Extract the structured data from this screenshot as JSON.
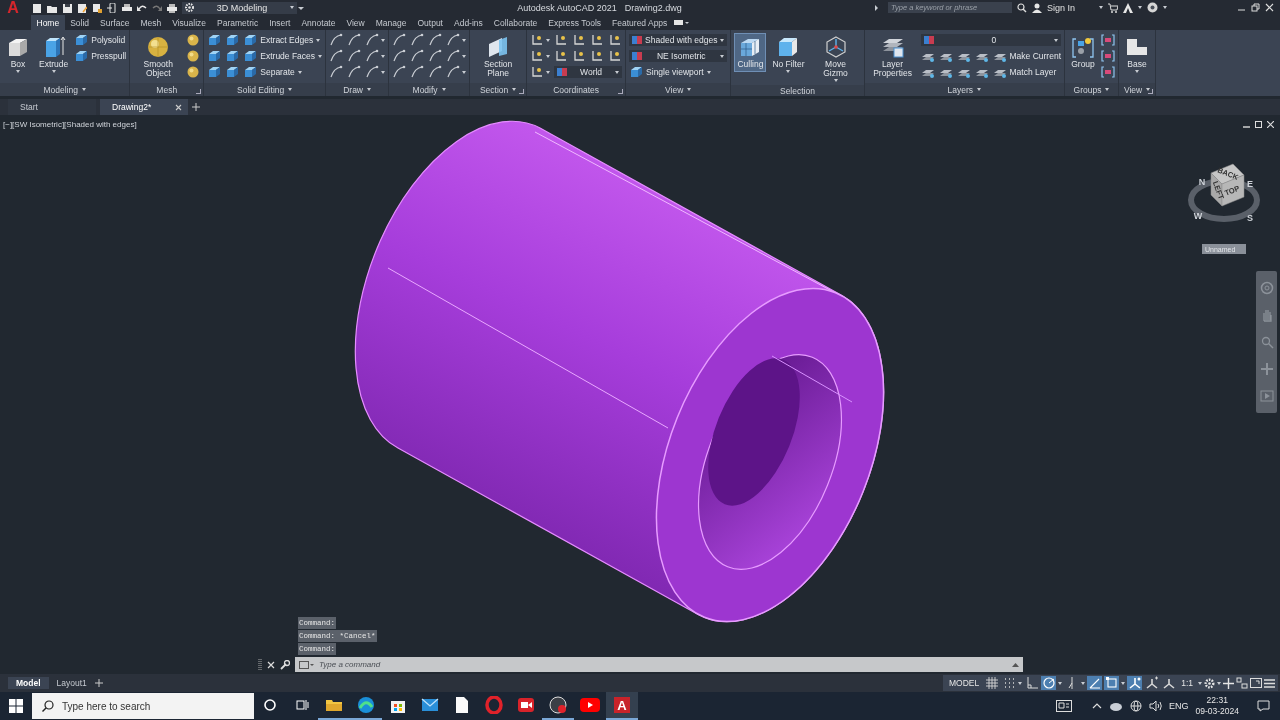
{
  "title_bar": {
    "logo": "A",
    "workspace": "3D Modeling",
    "title": "Autodesk AutoCAD 2021",
    "file": "Drawing2.dwg",
    "search_placeholder": "Type a keyword or phrase",
    "user": "Sign In"
  },
  "ribbon_tabs": [
    {
      "label": "Home",
      "selected": true
    },
    {
      "label": "Solid",
      "selected": false
    },
    {
      "label": "Surface",
      "selected": false
    },
    {
      "label": "Mesh",
      "selected": false
    },
    {
      "label": "Visualize",
      "selected": false
    },
    {
      "label": "Parametric",
      "selected": false
    },
    {
      "label": "Insert",
      "selected": false
    },
    {
      "label": "Annotate",
      "selected": false
    },
    {
      "label": "View",
      "selected": false
    },
    {
      "label": "Manage",
      "selected": false
    },
    {
      "label": "Output",
      "selected": false
    },
    {
      "label": "Add-ins",
      "selected": false
    },
    {
      "label": "Collaborate",
      "selected": false
    },
    {
      "label": "Express Tools",
      "selected": false
    },
    {
      "label": "Featured Apps",
      "selected": false
    }
  ],
  "panels": [
    {
      "title": "Modeling",
      "menu": true,
      "launcher": false,
      "large": [
        {
          "label": "Box",
          "caret": true,
          "on": false
        },
        {
          "label": "Extrude",
          "caret": true,
          "on": false
        }
      ],
      "rows": [
        [
          {
            "kind": "small",
            "label": "Polysolid",
            "caret": false
          }
        ],
        [
          {
            "kind": "small",
            "label": "Presspull",
            "caret": false
          }
        ]
      ]
    },
    {
      "title": "Mesh",
      "menu": false,
      "launcher": true,
      "large": [
        {
          "label": "Smooth Object",
          "caret": false,
          "on": false
        }
      ],
      "rows": [
        [
          {
            "kind": "icon",
            "caret": false
          }
        ],
        [
          {
            "kind": "icon",
            "caret": false
          }
        ],
        [
          {
            "kind": "icon",
            "caret": false
          }
        ]
      ]
    },
    {
      "title": "Solid Editing",
      "menu": true,
      "launcher": false,
      "rows": [
        [
          {
            "kind": "icon",
            "caret": false
          },
          {
            "kind": "icon",
            "caret": false
          },
          {
            "kind": "small",
            "label": "Extract Edges",
            "caret": true
          }
        ],
        [
          {
            "kind": "icon",
            "caret": false
          },
          {
            "kind": "icon",
            "caret": false
          },
          {
            "kind": "small",
            "label": "Extrude Faces",
            "caret": true
          }
        ],
        [
          {
            "kind": "icon",
            "caret": false
          },
          {
            "kind": "icon",
            "caret": false
          },
          {
            "kind": "small",
            "label": "Separate",
            "caret": true
          }
        ]
      ]
    },
    {
      "title": "Draw",
      "menu": true,
      "launcher": false,
      "rows": [
        [
          {
            "kind": "icon",
            "caret": false
          },
          {
            "kind": "icon",
            "caret": false
          },
          {
            "kind": "icon",
            "caret": true
          }
        ],
        [
          {
            "kind": "icon",
            "caret": false
          },
          {
            "kind": "icon",
            "caret": false
          },
          {
            "kind": "icon",
            "caret": true
          }
        ],
        [
          {
            "kind": "icon",
            "caret": false
          },
          {
            "kind": "icon",
            "caret": false
          },
          {
            "kind": "icon",
            "caret": true
          }
        ]
      ]
    },
    {
      "title": "Modify",
      "menu": true,
      "launcher": false,
      "rows": [
        [
          {
            "kind": "icon",
            "caret": false
          },
          {
            "kind": "icon",
            "caret": false
          },
          {
            "kind": "icon",
            "caret": false
          },
          {
            "kind": "icon",
            "caret": true
          }
        ],
        [
          {
            "kind": "icon",
            "caret": false
          },
          {
            "kind": "icon",
            "caret": false
          },
          {
            "kind": "icon",
            "caret": false
          },
          {
            "kind": "icon",
            "caret": true
          }
        ],
        [
          {
            "kind": "icon",
            "caret": false
          },
          {
            "kind": "icon",
            "caret": false
          },
          {
            "kind": "icon",
            "caret": false
          },
          {
            "kind": "icon",
            "caret": true
          }
        ]
      ]
    },
    {
      "title": "Section",
      "menu": true,
      "launcher": true,
      "large": [
        {
          "label": "Section Plane",
          "caret": false,
          "on": false
        }
      ]
    },
    {
      "title": "Coordinates",
      "menu": false,
      "launcher": true,
      "rows": [
        [
          {
            "kind": "icon",
            "caret": true
          },
          {
            "kind": "icon",
            "caret": false
          },
          {
            "kind": "icon",
            "caret": false
          },
          {
            "kind": "icon",
            "caret": false
          },
          {
            "kind": "icon",
            "caret": false
          }
        ],
        [
          {
            "kind": "icon",
            "caret": true
          },
          {
            "kind": "icon",
            "caret": false
          },
          {
            "kind": "icon",
            "caret": false
          },
          {
            "kind": "icon",
            "caret": false
          },
          {
            "kind": "icon",
            "caret": false
          }
        ],
        [
          {
            "kind": "icon",
            "caret": true
          },
          {
            "kind": "dropdown",
            "value": "World"
          }
        ]
      ]
    },
    {
      "title": "View",
      "menu": true,
      "launcher": false,
      "rows": [
        [
          {
            "kind": "dropdown",
            "value": "Shaded with edges"
          }
        ],
        [
          {
            "kind": "dropdown",
            "value": "NE Isometric"
          }
        ],
        [
          {
            "kind": "small",
            "label": "Single viewport",
            "caret": true
          }
        ]
      ]
    },
    {
      "title": "Selection",
      "menu": false,
      "launcher": false,
      "large": [
        {
          "label": "Culling",
          "caret": false,
          "on": true
        },
        {
          "label": "No Filter",
          "caret": true,
          "on": false
        },
        {
          "label": "Move Gizmo",
          "caret": true,
          "on": false
        }
      ]
    },
    {
      "title": "Layers",
      "menu": true,
      "launcher": false,
      "large": [
        {
          "label": "Layer Properties",
          "caret": false,
          "on": false
        }
      ],
      "rows": [
        [
          {
            "kind": "dropdown",
            "value": "0"
          }
        ],
        [
          {
            "kind": "icon",
            "caret": false
          },
          {
            "kind": "icon",
            "caret": false
          },
          {
            "kind": "icon",
            "caret": false
          },
          {
            "kind": "icon",
            "caret": false
          },
          {
            "kind": "small",
            "label": "Make Current",
            "caret": false
          }
        ],
        [
          {
            "kind": "icon",
            "caret": false
          },
          {
            "kind": "icon",
            "caret": false
          },
          {
            "kind": "icon",
            "caret": false
          },
          {
            "kind": "icon",
            "caret": false
          },
          {
            "kind": "small",
            "label": "Match Layer",
            "caret": false
          }
        ]
      ]
    },
    {
      "title": "Groups",
      "menu": true,
      "launcher": false,
      "large": [
        {
          "label": "Group",
          "caret": false,
          "on": false
        }
      ],
      "rows": [
        [
          {
            "kind": "icon",
            "caret": false
          }
        ],
        [
          {
            "kind": "icon",
            "caret": false
          }
        ],
        [
          {
            "kind": "icon",
            "caret": false
          }
        ]
      ]
    },
    {
      "title": "View",
      "menu": true,
      "launcher": true,
      "large": [
        {
          "label": "Base",
          "caret": true,
          "on": false
        }
      ]
    }
  ],
  "doc_tabs": [
    {
      "label": "Start",
      "selected": false,
      "closable": false
    },
    {
      "label": "Drawing2*",
      "selected": true,
      "closable": true
    }
  ],
  "viewport": {
    "label": "[−][SW Isometric][Shaded with edges]",
    "viewcube": {
      "faces": [
        "BACK",
        "LEFT",
        "TOP"
      ],
      "compass": [
        "N",
        "E",
        "W",
        "S"
      ]
    },
    "view_name": "Unnamed"
  },
  "command_line": {
    "history": [
      "Command:",
      "Command: *Cancel*",
      "Command:"
    ],
    "placeholder": "Type a command"
  },
  "layout_tabs": [
    {
      "label": "Model",
      "selected": true
    },
    {
      "label": "Layout1",
      "selected": false
    }
  ],
  "status_bar": {
    "space": "MODEL",
    "toggles": [
      {
        "on": false
      },
      {
        "on": false
      },
      {
        "on": false
      },
      {
        "on": true
      },
      {
        "on": false
      },
      {
        "on": true
      },
      {
        "on": true
      },
      {
        "on": true
      },
      {
        "on": false
      },
      {
        "on": false
      }
    ],
    "scale": "1:1"
  },
  "taskbar": {
    "search_placeholder": "Type here to search",
    "apps": [
      {
        "kind": "folder",
        "running": true,
        "selected": false
      },
      {
        "kind": "edge",
        "running": true,
        "selected": false
      },
      {
        "kind": "store",
        "running": false,
        "selected": false
      },
      {
        "kind": "mail",
        "running": false,
        "selected": false
      },
      {
        "kind": "file",
        "running": false,
        "selected": false
      },
      {
        "kind": "opera",
        "running": false,
        "selected": false
      },
      {
        "kind": "camera",
        "running": false,
        "selected": false
      },
      {
        "kind": "recorder",
        "running": true,
        "selected": false
      },
      {
        "kind": "youtube",
        "running": false,
        "selected": false
      },
      {
        "kind": "autocad",
        "letter": "A",
        "running": true,
        "selected": true
      }
    ],
    "language": "ENG",
    "time": "22:31",
    "date": "09-03-2024"
  }
}
